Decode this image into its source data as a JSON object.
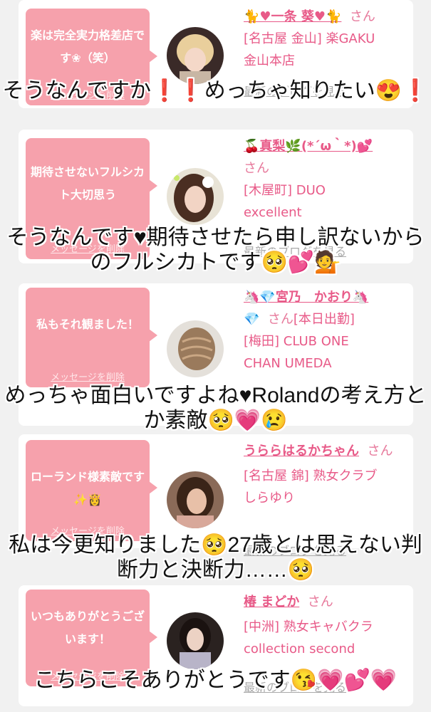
{
  "delete_label": "メッセージを削除",
  "blog_label": "最新のブログを見る",
  "san": "さん",
  "colors": {
    "bubble": "#f6a1ac",
    "link": "#e85a88",
    "background": "#f1f1f1"
  },
  "cards": [
    {
      "message": "楽は完全実力格差店です❀（笑）",
      "name": "🐈♥一条 葵♥🐈",
      "store_line1": "[名古屋 金山] 楽GAKU",
      "store_line2": "金山本店",
      "avatar_icon": "avatar-photo-blonde"
    },
    {
      "message": "期待させないフルシカト大切思う",
      "name": "🍒真梨🌿(*´ω｀*)💕",
      "store_line1": "[木屋町] DUO",
      "store_line2": "excellent",
      "avatar_icon": "avatar-photo-brunette"
    },
    {
      "message": "私もそれ観ました！",
      "name": "🦄💎宮乃　かおり🦄",
      "name_extra": "💎",
      "status": "[本日出勤]",
      "store_line1": "[梅田] CLUB ONE",
      "store_line2": "CHAN UMEDA",
      "avatar_icon": "avatar-photo-braid"
    },
    {
      "message": "ローランド様素敵です✨👸",
      "name": "うららはるかちゃん",
      "store_line1": "[名古屋 錦] 熟女クラブ",
      "store_line2": "しらゆり",
      "avatar_icon": "avatar-photo-woman"
    },
    {
      "message": "いつもありがとうございます！",
      "name": "椿 まどか",
      "store_line1": "[中洲] 熟女キャバクラ",
      "store_line2": "collection second",
      "avatar_icon": "avatar-photo-kimono"
    }
  ],
  "captions": [
    "そうなんですか❗❗めっちゃ知りたい😍❗",
    "そうなんです♥期待させたら申し訳ないからのフルシカトです🥺💕💁",
    "めっちゃ面白いですよね♥Rolandの考え方とか素敵🥺💗😢",
    "私は今更知りました🥺27歳とは思えない判断力と決断力……🥺",
    "こちらこそありがとうです😘💗💕💗"
  ]
}
